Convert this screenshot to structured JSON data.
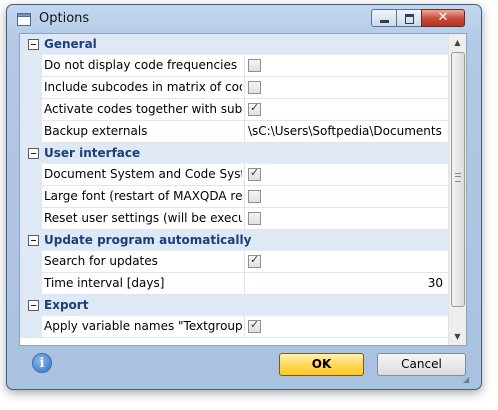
{
  "window": {
    "title": "Options",
    "close_glyph": "✕"
  },
  "sections": [
    {
      "label": "General",
      "rows": [
        {
          "name": "Do not display code frequencies in",
          "type": "checkbox",
          "checked": false
        },
        {
          "name": "Include subcodes in matrix of code",
          "type": "checkbox",
          "checked": false
        },
        {
          "name": "Activate codes together with subco",
          "type": "checkbox",
          "checked": true
        },
        {
          "name": "Backup externals",
          "type": "text",
          "value": "\\sC:\\Users\\Softpedia\\Documents"
        }
      ]
    },
    {
      "label": "User interface",
      "rows": [
        {
          "name": "Document System and Code Syster",
          "type": "checkbox",
          "checked": true
        },
        {
          "name": "Large font (restart of MAXQDA requ",
          "type": "checkbox",
          "checked": false
        },
        {
          "name": "Reset user settings (will be executed",
          "type": "checkbox",
          "checked": false
        }
      ]
    },
    {
      "label": "Update program automatically",
      "rows": [
        {
          "name": "Search for updates",
          "type": "checkbox",
          "checked": true
        },
        {
          "name": "Time interval [days]",
          "type": "number",
          "value": "30"
        }
      ]
    },
    {
      "label": "Export",
      "rows": [
        {
          "name": "Apply variable names \"Textgroup\" a",
          "type": "checkbox",
          "checked": true
        }
      ]
    }
  ],
  "buttons": {
    "info": "i",
    "ok": "OK",
    "cancel": "Cancel"
  },
  "icons": {
    "app": "window-icon",
    "minimize": "minimize-icon",
    "maximize": "maximize-icon",
    "close": "close-icon",
    "collapse": "minus-box-icon",
    "scroll_up": "arrow-up-icon",
    "scroll_down": "arrow-down-icon",
    "info": "info-icon",
    "resize": "resize-grip-icon"
  }
}
